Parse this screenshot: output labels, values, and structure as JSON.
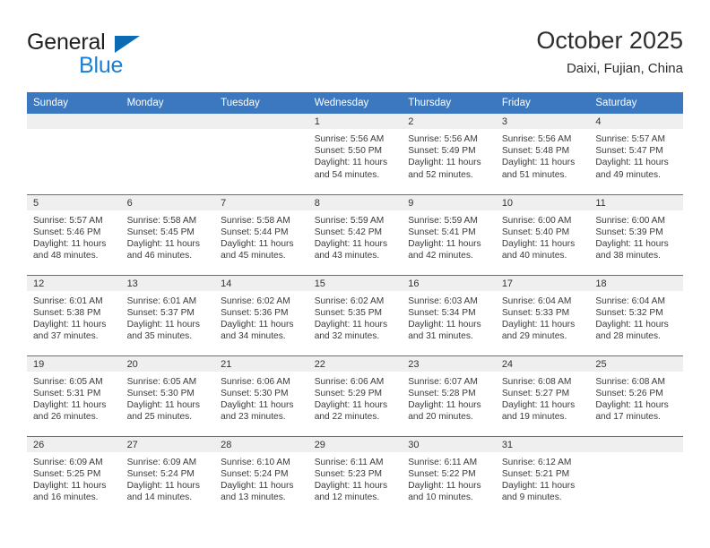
{
  "brand": {
    "name_part1": "General",
    "name_part2": "Blue",
    "logo_icon": "triangle-flag-icon",
    "accent_color": "#1a7fd4",
    "dark_accent_color": "#0b6cb3"
  },
  "header": {
    "title": "October 2025",
    "subtitle": "Daixi, Fujian, China",
    "header_bg_color": "#3b78c0",
    "daynum_strip_color": "#efefef"
  },
  "columns": [
    "Sunday",
    "Monday",
    "Tuesday",
    "Wednesday",
    "Thursday",
    "Friday",
    "Saturday"
  ],
  "weeks": [
    [
      {
        "empty": true
      },
      {
        "empty": true
      },
      {
        "empty": true
      },
      {
        "day": "1",
        "sunrise": "Sunrise: 5:56 AM",
        "sunset": "Sunset: 5:50 PM",
        "daylight_line1": "Daylight: 11 hours",
        "daylight_line2": "and 54 minutes."
      },
      {
        "day": "2",
        "sunrise": "Sunrise: 5:56 AM",
        "sunset": "Sunset: 5:49 PM",
        "daylight_line1": "Daylight: 11 hours",
        "daylight_line2": "and 52 minutes."
      },
      {
        "day": "3",
        "sunrise": "Sunrise: 5:56 AM",
        "sunset": "Sunset: 5:48 PM",
        "daylight_line1": "Daylight: 11 hours",
        "daylight_line2": "and 51 minutes."
      },
      {
        "day": "4",
        "sunrise": "Sunrise: 5:57 AM",
        "sunset": "Sunset: 5:47 PM",
        "daylight_line1": "Daylight: 11 hours",
        "daylight_line2": "and 49 minutes."
      }
    ],
    [
      {
        "day": "5",
        "sunrise": "Sunrise: 5:57 AM",
        "sunset": "Sunset: 5:46 PM",
        "daylight_line1": "Daylight: 11 hours",
        "daylight_line2": "and 48 minutes."
      },
      {
        "day": "6",
        "sunrise": "Sunrise: 5:58 AM",
        "sunset": "Sunset: 5:45 PM",
        "daylight_line1": "Daylight: 11 hours",
        "daylight_line2": "and 46 minutes."
      },
      {
        "day": "7",
        "sunrise": "Sunrise: 5:58 AM",
        "sunset": "Sunset: 5:44 PM",
        "daylight_line1": "Daylight: 11 hours",
        "daylight_line2": "and 45 minutes."
      },
      {
        "day": "8",
        "sunrise": "Sunrise: 5:59 AM",
        "sunset": "Sunset: 5:42 PM",
        "daylight_line1": "Daylight: 11 hours",
        "daylight_line2": "and 43 minutes."
      },
      {
        "day": "9",
        "sunrise": "Sunrise: 5:59 AM",
        "sunset": "Sunset: 5:41 PM",
        "daylight_line1": "Daylight: 11 hours",
        "daylight_line2": "and 42 minutes."
      },
      {
        "day": "10",
        "sunrise": "Sunrise: 6:00 AM",
        "sunset": "Sunset: 5:40 PM",
        "daylight_line1": "Daylight: 11 hours",
        "daylight_line2": "and 40 minutes."
      },
      {
        "day": "11",
        "sunrise": "Sunrise: 6:00 AM",
        "sunset": "Sunset: 5:39 PM",
        "daylight_line1": "Daylight: 11 hours",
        "daylight_line2": "and 38 minutes."
      }
    ],
    [
      {
        "day": "12",
        "sunrise": "Sunrise: 6:01 AM",
        "sunset": "Sunset: 5:38 PM",
        "daylight_line1": "Daylight: 11 hours",
        "daylight_line2": "and 37 minutes."
      },
      {
        "day": "13",
        "sunrise": "Sunrise: 6:01 AM",
        "sunset": "Sunset: 5:37 PM",
        "daylight_line1": "Daylight: 11 hours",
        "daylight_line2": "and 35 minutes."
      },
      {
        "day": "14",
        "sunrise": "Sunrise: 6:02 AM",
        "sunset": "Sunset: 5:36 PM",
        "daylight_line1": "Daylight: 11 hours",
        "daylight_line2": "and 34 minutes."
      },
      {
        "day": "15",
        "sunrise": "Sunrise: 6:02 AM",
        "sunset": "Sunset: 5:35 PM",
        "daylight_line1": "Daylight: 11 hours",
        "daylight_line2": "and 32 minutes."
      },
      {
        "day": "16",
        "sunrise": "Sunrise: 6:03 AM",
        "sunset": "Sunset: 5:34 PM",
        "daylight_line1": "Daylight: 11 hours",
        "daylight_line2": "and 31 minutes."
      },
      {
        "day": "17",
        "sunrise": "Sunrise: 6:04 AM",
        "sunset": "Sunset: 5:33 PM",
        "daylight_line1": "Daylight: 11 hours",
        "daylight_line2": "and 29 minutes."
      },
      {
        "day": "18",
        "sunrise": "Sunrise: 6:04 AM",
        "sunset": "Sunset: 5:32 PM",
        "daylight_line1": "Daylight: 11 hours",
        "daylight_line2": "and 28 minutes."
      }
    ],
    [
      {
        "day": "19",
        "sunrise": "Sunrise: 6:05 AM",
        "sunset": "Sunset: 5:31 PM",
        "daylight_line1": "Daylight: 11 hours",
        "daylight_line2": "and 26 minutes."
      },
      {
        "day": "20",
        "sunrise": "Sunrise: 6:05 AM",
        "sunset": "Sunset: 5:30 PM",
        "daylight_line1": "Daylight: 11 hours",
        "daylight_line2": "and 25 minutes."
      },
      {
        "day": "21",
        "sunrise": "Sunrise: 6:06 AM",
        "sunset": "Sunset: 5:30 PM",
        "daylight_line1": "Daylight: 11 hours",
        "daylight_line2": "and 23 minutes."
      },
      {
        "day": "22",
        "sunrise": "Sunrise: 6:06 AM",
        "sunset": "Sunset: 5:29 PM",
        "daylight_line1": "Daylight: 11 hours",
        "daylight_line2": "and 22 minutes."
      },
      {
        "day": "23",
        "sunrise": "Sunrise: 6:07 AM",
        "sunset": "Sunset: 5:28 PM",
        "daylight_line1": "Daylight: 11 hours",
        "daylight_line2": "and 20 minutes."
      },
      {
        "day": "24",
        "sunrise": "Sunrise: 6:08 AM",
        "sunset": "Sunset: 5:27 PM",
        "daylight_line1": "Daylight: 11 hours",
        "daylight_line2": "and 19 minutes."
      },
      {
        "day": "25",
        "sunrise": "Sunrise: 6:08 AM",
        "sunset": "Sunset: 5:26 PM",
        "daylight_line1": "Daylight: 11 hours",
        "daylight_line2": "and 17 minutes."
      }
    ],
    [
      {
        "day": "26",
        "sunrise": "Sunrise: 6:09 AM",
        "sunset": "Sunset: 5:25 PM",
        "daylight_line1": "Daylight: 11 hours",
        "daylight_line2": "and 16 minutes."
      },
      {
        "day": "27",
        "sunrise": "Sunrise: 6:09 AM",
        "sunset": "Sunset: 5:24 PM",
        "daylight_line1": "Daylight: 11 hours",
        "daylight_line2": "and 14 minutes."
      },
      {
        "day": "28",
        "sunrise": "Sunrise: 6:10 AM",
        "sunset": "Sunset: 5:24 PM",
        "daylight_line1": "Daylight: 11 hours",
        "daylight_line2": "and 13 minutes."
      },
      {
        "day": "29",
        "sunrise": "Sunrise: 6:11 AM",
        "sunset": "Sunset: 5:23 PM",
        "daylight_line1": "Daylight: 11 hours",
        "daylight_line2": "and 12 minutes."
      },
      {
        "day": "30",
        "sunrise": "Sunrise: 6:11 AM",
        "sunset": "Sunset: 5:22 PM",
        "daylight_line1": "Daylight: 11 hours",
        "daylight_line2": "and 10 minutes."
      },
      {
        "day": "31",
        "sunrise": "Sunrise: 6:12 AM",
        "sunset": "Sunset: 5:21 PM",
        "daylight_line1": "Daylight: 11 hours",
        "daylight_line2": "and 9 minutes."
      },
      {
        "empty": true
      }
    ]
  ]
}
